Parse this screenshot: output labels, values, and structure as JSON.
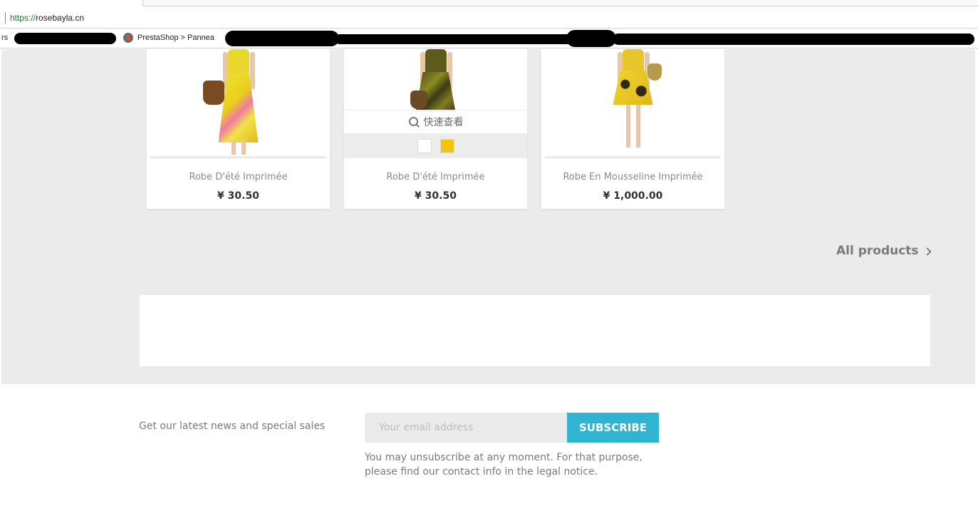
{
  "browser": {
    "url_scheme": "https://",
    "url_host": "rosebayla.cn",
    "bookmarks": {
      "left_fragment": "rs",
      "prestashop_label": "PrestaShop > Pannea"
    }
  },
  "products": [
    {
      "name": "Robe D'été Imprimée",
      "price": "¥ 30.50"
    },
    {
      "name": "Robe D'été Imprimée",
      "price": "¥ 30.50",
      "quick_view": "快速查看",
      "swatches": [
        "#ffffff",
        "#f1c40f"
      ]
    },
    {
      "name": "Robe En Mousseline Imprimée",
      "price": "¥ 1,000.00"
    }
  ],
  "all_products_label": "All products",
  "newsletter": {
    "label": "Get our latest news and special sales",
    "placeholder": "Your email address",
    "button": "SUBSCRIBE",
    "note": "You may unsubscribe at any moment. For that purpose, please find our contact info in the legal notice."
  },
  "colors": {
    "accent": "#2fb5d2",
    "background_gray": "#ebebeb"
  }
}
